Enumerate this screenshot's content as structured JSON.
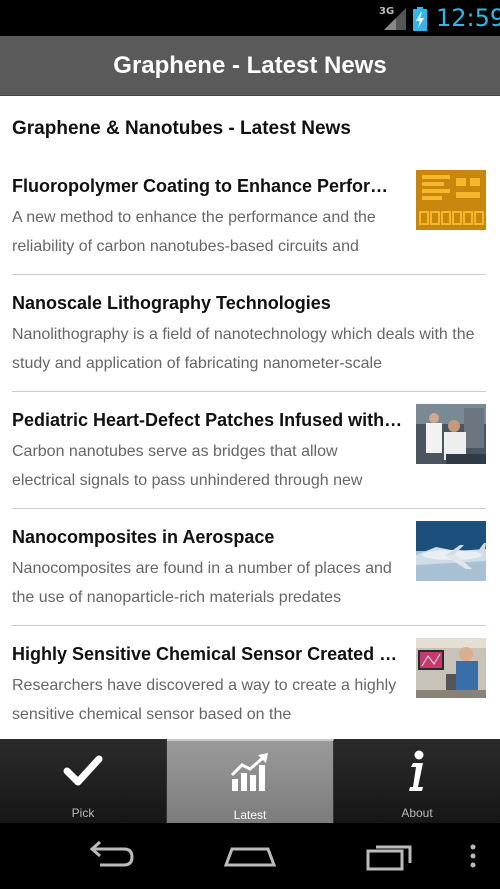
{
  "status_bar": {
    "network": "3G",
    "time": "12:59"
  },
  "app": {
    "title": "Graphene - Latest News"
  },
  "section_title": "Graphene & Nanotubes - Latest News",
  "news": [
    {
      "headline": "Fluoropolymer Coating to Enhance Performance of Carbon Nanotubes",
      "snippet": "A new method to enhance the performance and the reliability of carbon nanotubes-based circuits and",
      "thumb": "circuit-chip-thumbnail"
    },
    {
      "headline": "Nanoscale Lithography Technologies",
      "snippet": "Nanolithography is a field of nanotechnology which deals with the study and application of fabricating nanometer-scale",
      "thumb": ""
    },
    {
      "headline": "Pediatric Heart-Defect Patches Infused with Carbon Nanotubes",
      "snippet": "Carbon nanotubes serve as bridges that allow electrical signals to pass unhindered through new",
      "thumb": "lab-researchers-thumbnail"
    },
    {
      "headline": "Nanocomposites in Aerospace",
      "snippet": "Nanocomposites are found in a number of places and the use of nanoparticle-rich materials predates",
      "thumb": "airplane-thumbnail"
    },
    {
      "headline": "Highly Sensitive Chemical Sensor Created Using Carbon Nanotubes",
      "snippet": "Researchers have discovered a way to create a highly sensitive chemical sensor based on the",
      "thumb": "microscope-researcher-thumbnail"
    }
  ],
  "tabs": [
    {
      "label": "Pick",
      "icon": "checkmark-icon",
      "active": false
    },
    {
      "label": "Latest",
      "icon": "chart-growth-icon",
      "active": true
    },
    {
      "label": "About",
      "icon": "info-icon",
      "active": false
    }
  ],
  "colors": {
    "accent": "#33b5e5",
    "title_bar": "#5a5a5a",
    "active_tab": "#8a8a8a"
  }
}
